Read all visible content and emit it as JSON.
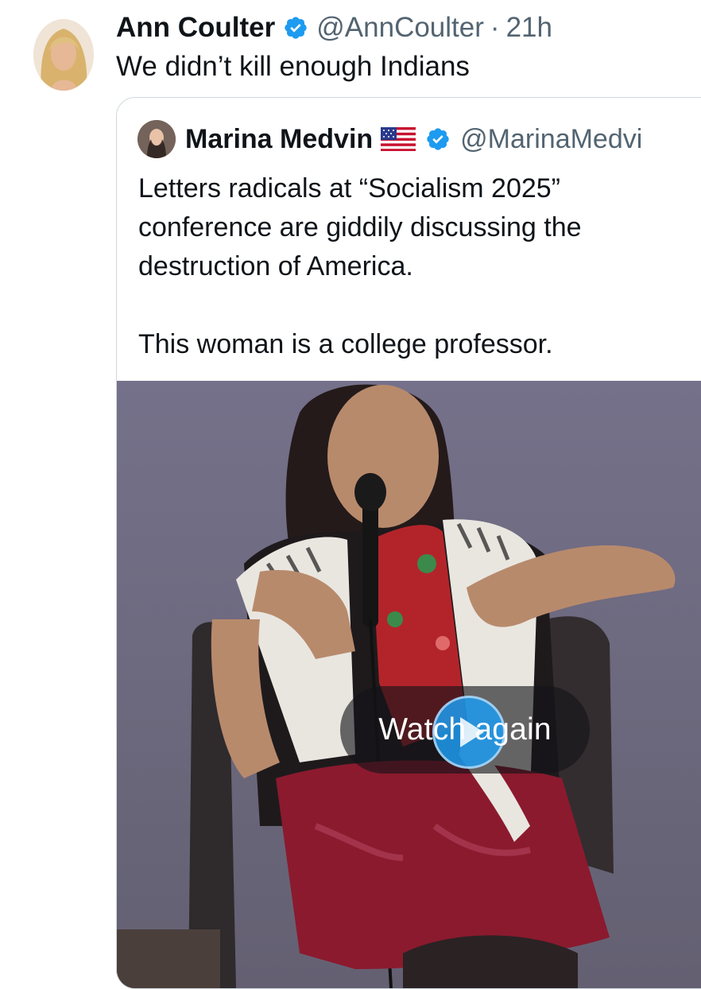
{
  "post": {
    "author_name": "Ann Coulter",
    "handle": "@AnnCoulter",
    "separator": "·",
    "timestamp": "21h",
    "text": "We didn’t kill enough Indians"
  },
  "quoted_post": {
    "author_name": "Marina Medvin",
    "handle": "@MarinaMedvi",
    "text_lines": [
      "Letters radicals at “Socialism 2025”",
      "conference are giddily discussing the",
      "destruction of America.",
      "This woman is a college professor."
    ]
  },
  "video": {
    "watch_again_label": "Watch again"
  },
  "icons": {
    "verified": "verified-badge-icon",
    "flag": "us-flag-icon",
    "replay": "play-icon"
  },
  "colors": {
    "verified_blue": "#1d9bf0",
    "secondary_text": "#536471",
    "border": "#cfd9de"
  }
}
